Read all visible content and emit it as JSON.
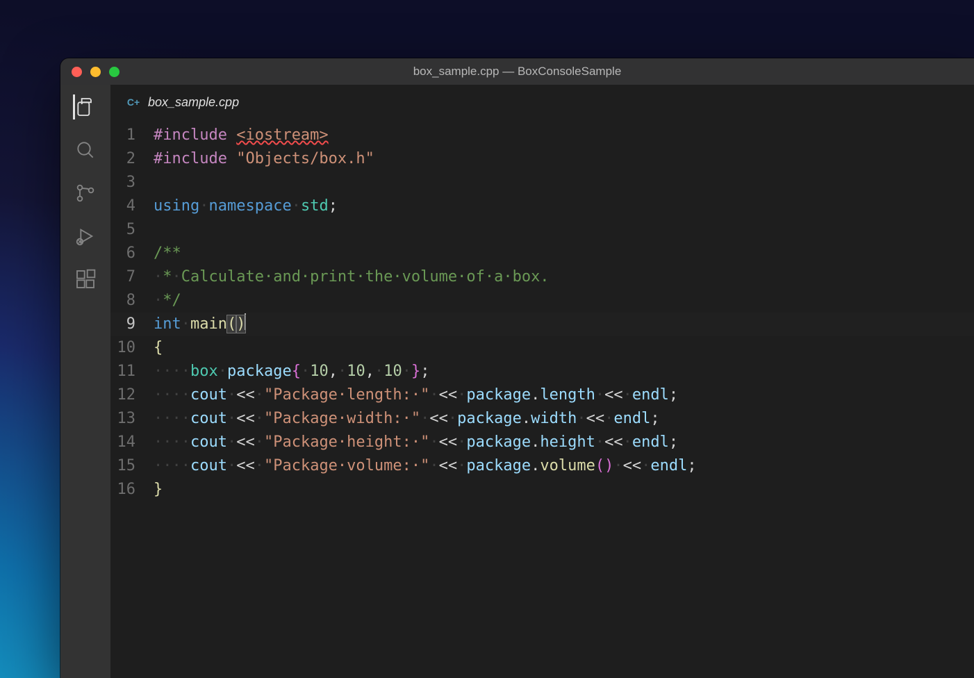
{
  "window": {
    "title": "box_sample.cpp — BoxConsoleSample"
  },
  "tab": {
    "filename": "box_sample.cpp",
    "language_icon": "C+"
  },
  "activitybar": {
    "items": [
      {
        "name": "explorer-icon",
        "active": true
      },
      {
        "name": "search-icon",
        "active": false
      },
      {
        "name": "scm-icon",
        "active": false
      },
      {
        "name": "debug-icon",
        "active": false
      },
      {
        "name": "extensions-icon",
        "active": false
      }
    ]
  },
  "code": {
    "current_line": 9,
    "lines": [
      {
        "n": 1,
        "tokens": [
          {
            "t": "#include",
            "c": "kw"
          },
          {
            "t": " ",
            "c": "ws"
          },
          {
            "t": "<iostream>",
            "c": "str sqerr"
          }
        ]
      },
      {
        "n": 2,
        "tokens": [
          {
            "t": "#include",
            "c": "kw"
          },
          {
            "t": " ",
            "c": "ws"
          },
          {
            "t": "\"Objects/box.h\"",
            "c": "str"
          }
        ]
      },
      {
        "n": 3,
        "tokens": []
      },
      {
        "n": 4,
        "tokens": [
          {
            "t": "using",
            "c": "kw2"
          },
          {
            "t": "·",
            "c": "ws"
          },
          {
            "t": "namespace",
            "c": "kw2"
          },
          {
            "t": "·",
            "c": "ws"
          },
          {
            "t": "std",
            "c": "typ"
          },
          {
            "t": ";",
            "c": "pun"
          }
        ]
      },
      {
        "n": 5,
        "tokens": []
      },
      {
        "n": 6,
        "tokens": [
          {
            "t": "/**",
            "c": "cmt"
          }
        ]
      },
      {
        "n": 7,
        "tokens": [
          {
            "t": "·",
            "c": "ws",
            "guide": true
          },
          {
            "t": "*",
            "c": "cmt"
          },
          {
            "t": "·",
            "c": "ws"
          },
          {
            "t": "Calculate·and·print·the·volume·of·a·box.",
            "c": "cmt dot"
          }
        ]
      },
      {
        "n": 8,
        "tokens": [
          {
            "t": "·",
            "c": "ws",
            "guide": true
          },
          {
            "t": "*/",
            "c": "cmt"
          }
        ]
      },
      {
        "n": 9,
        "tokens": [
          {
            "t": "int",
            "c": "kw2"
          },
          {
            "t": "·",
            "c": "ws"
          },
          {
            "t": "main",
            "c": "fn"
          },
          {
            "t": "(",
            "c": "brace1 bracket-hl"
          },
          {
            "t": ")",
            "c": "brace1 bracket-hl"
          },
          {
            "t": "",
            "c": "cursor"
          }
        ]
      },
      {
        "n": 10,
        "tokens": [
          {
            "t": "{",
            "c": "brace1"
          }
        ]
      },
      {
        "n": 11,
        "tokens": [
          {
            "t": "····",
            "c": "ws",
            "guide": true
          },
          {
            "t": "box",
            "c": "typ"
          },
          {
            "t": "·",
            "c": "ws"
          },
          {
            "t": "package",
            "c": "var"
          },
          {
            "t": "{",
            "c": "brace"
          },
          {
            "t": "·",
            "c": "ws"
          },
          {
            "t": "10",
            "c": "num"
          },
          {
            "t": ",",
            "c": "pun"
          },
          {
            "t": "·",
            "c": "ws"
          },
          {
            "t": "10",
            "c": "num"
          },
          {
            "t": ",",
            "c": "pun"
          },
          {
            "t": "·",
            "c": "ws"
          },
          {
            "t": "10",
            "c": "num"
          },
          {
            "t": "·",
            "c": "ws"
          },
          {
            "t": "}",
            "c": "brace"
          },
          {
            "t": ";",
            "c": "pun"
          }
        ]
      },
      {
        "n": 12,
        "tokens": [
          {
            "t": "····",
            "c": "ws",
            "guide": true
          },
          {
            "t": "cout",
            "c": "var"
          },
          {
            "t": "·",
            "c": "ws"
          },
          {
            "t": "<<",
            "c": "op"
          },
          {
            "t": "·",
            "c": "ws"
          },
          {
            "t": "\"Package·length:·\"",
            "c": "str"
          },
          {
            "t": "·",
            "c": "ws"
          },
          {
            "t": "<<",
            "c": "op"
          },
          {
            "t": "·",
            "c": "ws"
          },
          {
            "t": "package",
            "c": "var"
          },
          {
            "t": ".",
            "c": "pun"
          },
          {
            "t": "length",
            "c": "var"
          },
          {
            "t": "·",
            "c": "ws"
          },
          {
            "t": "<<",
            "c": "op"
          },
          {
            "t": "·",
            "c": "ws"
          },
          {
            "t": "endl",
            "c": "var"
          },
          {
            "t": ";",
            "c": "pun"
          }
        ]
      },
      {
        "n": 13,
        "tokens": [
          {
            "t": "····",
            "c": "ws",
            "guide": true
          },
          {
            "t": "cout",
            "c": "var"
          },
          {
            "t": "·",
            "c": "ws"
          },
          {
            "t": "<<",
            "c": "op"
          },
          {
            "t": "·",
            "c": "ws"
          },
          {
            "t": "\"Package·width:·\"",
            "c": "str"
          },
          {
            "t": "·",
            "c": "ws"
          },
          {
            "t": "<<",
            "c": "op"
          },
          {
            "t": "·",
            "c": "ws"
          },
          {
            "t": "package",
            "c": "var"
          },
          {
            "t": ".",
            "c": "pun"
          },
          {
            "t": "width",
            "c": "var"
          },
          {
            "t": "·",
            "c": "ws"
          },
          {
            "t": "<<",
            "c": "op"
          },
          {
            "t": "·",
            "c": "ws"
          },
          {
            "t": "endl",
            "c": "var"
          },
          {
            "t": ";",
            "c": "pun"
          }
        ]
      },
      {
        "n": 14,
        "tokens": [
          {
            "t": "····",
            "c": "ws",
            "guide": true
          },
          {
            "t": "cout",
            "c": "var"
          },
          {
            "t": "·",
            "c": "ws"
          },
          {
            "t": "<<",
            "c": "op"
          },
          {
            "t": "·",
            "c": "ws"
          },
          {
            "t": "\"Package·height:·\"",
            "c": "str"
          },
          {
            "t": "·",
            "c": "ws"
          },
          {
            "t": "<<",
            "c": "op"
          },
          {
            "t": "·",
            "c": "ws"
          },
          {
            "t": "package",
            "c": "var"
          },
          {
            "t": ".",
            "c": "pun"
          },
          {
            "t": "height",
            "c": "var"
          },
          {
            "t": "·",
            "c": "ws"
          },
          {
            "t": "<<",
            "c": "op"
          },
          {
            "t": "·",
            "c": "ws"
          },
          {
            "t": "endl",
            "c": "var"
          },
          {
            "t": ";",
            "c": "pun"
          }
        ]
      },
      {
        "n": 15,
        "tokens": [
          {
            "t": "····",
            "c": "ws",
            "guide": true
          },
          {
            "t": "cout",
            "c": "var"
          },
          {
            "t": "·",
            "c": "ws"
          },
          {
            "t": "<<",
            "c": "op"
          },
          {
            "t": "·",
            "c": "ws"
          },
          {
            "t": "\"Package·volume:·\"",
            "c": "str"
          },
          {
            "t": "·",
            "c": "ws"
          },
          {
            "t": "<<",
            "c": "op"
          },
          {
            "t": "·",
            "c": "ws"
          },
          {
            "t": "package",
            "c": "var"
          },
          {
            "t": ".",
            "c": "pun"
          },
          {
            "t": "volume",
            "c": "fn"
          },
          {
            "t": "(",
            "c": "brace"
          },
          {
            "t": ")",
            "c": "brace"
          },
          {
            "t": "·",
            "c": "ws"
          },
          {
            "t": "<<",
            "c": "op"
          },
          {
            "t": "·",
            "c": "ws"
          },
          {
            "t": "endl",
            "c": "var"
          },
          {
            "t": ";",
            "c": "pun"
          }
        ]
      },
      {
        "n": 16,
        "tokens": [
          {
            "t": "}",
            "c": "brace1"
          }
        ]
      }
    ]
  }
}
